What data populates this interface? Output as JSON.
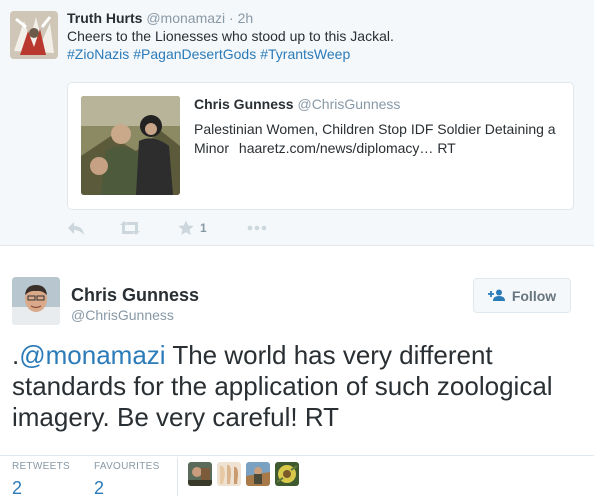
{
  "parent_tweet": {
    "author_name": "Truth Hurts",
    "author_handle": "@monamazi",
    "time": "· 2h",
    "text": "Cheers to the Lionesses who stood up to this Jackal.",
    "hashtags": [
      "#ZioNazis",
      "#PaganDesertGods",
      "#TyrantsWeep"
    ],
    "quoted": {
      "author_name": "Chris Gunness",
      "author_handle": "@ChrisGunness",
      "text": "Palestinian Women, Children Stop IDF Soldier Detaining a Minor",
      "url": "haaretz.com/news/diplomacy… RT"
    },
    "actions": {
      "reply_icon": "reply-icon",
      "retweet_icon": "retweet-icon",
      "favorite_icon": "star-icon",
      "favorite_count": "1",
      "more_icon": "more-icon"
    }
  },
  "main_tweet": {
    "author_name": "Chris Gunness",
    "author_handle": "@ChrisGunness",
    "follow_label": "Follow",
    "text_prefix": ".",
    "mention": "@monamazi",
    "text": " The world has very different standards for the application of such zoological imagery. Be very careful! RT",
    "stats": {
      "retweets_label": "RETWEETS",
      "retweets_value": "2",
      "favourites_label": "FAVOURITES",
      "favourites_value": "2"
    }
  },
  "colors": {
    "link": "#2b7bb9",
    "muted": "#8899a6",
    "background_alt": "#f5f8fa",
    "border": "#e1e8ed"
  }
}
